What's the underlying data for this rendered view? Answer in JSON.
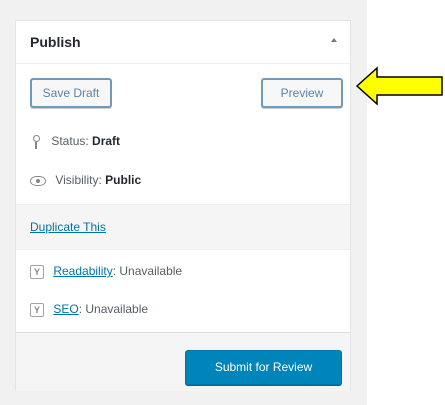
{
  "panel": {
    "title": "Publish",
    "save_draft_label": "Save Draft",
    "preview_label": "Preview",
    "status": {
      "label": "Status:",
      "value": "Draft"
    },
    "visibility": {
      "label": "Visibility:",
      "value": "Public"
    },
    "duplicate_label": "Duplicate This",
    "readability": {
      "link": "Readability",
      "value": ": Unavailable"
    },
    "seo": {
      "link": "SEO",
      "value": ": Unavailable"
    },
    "submit_label": "Submit for Review"
  },
  "icons": {
    "status": "pin-icon",
    "visibility": "eye-icon",
    "readability": "yoast-icon",
    "seo": "yoast-icon",
    "toggle": "chevron-up-icon",
    "annotation": "arrow-left-icon"
  },
  "colors": {
    "primary_button": "#0085ba",
    "link": "#0073aa",
    "annotation_arrow": "#ffff00"
  }
}
